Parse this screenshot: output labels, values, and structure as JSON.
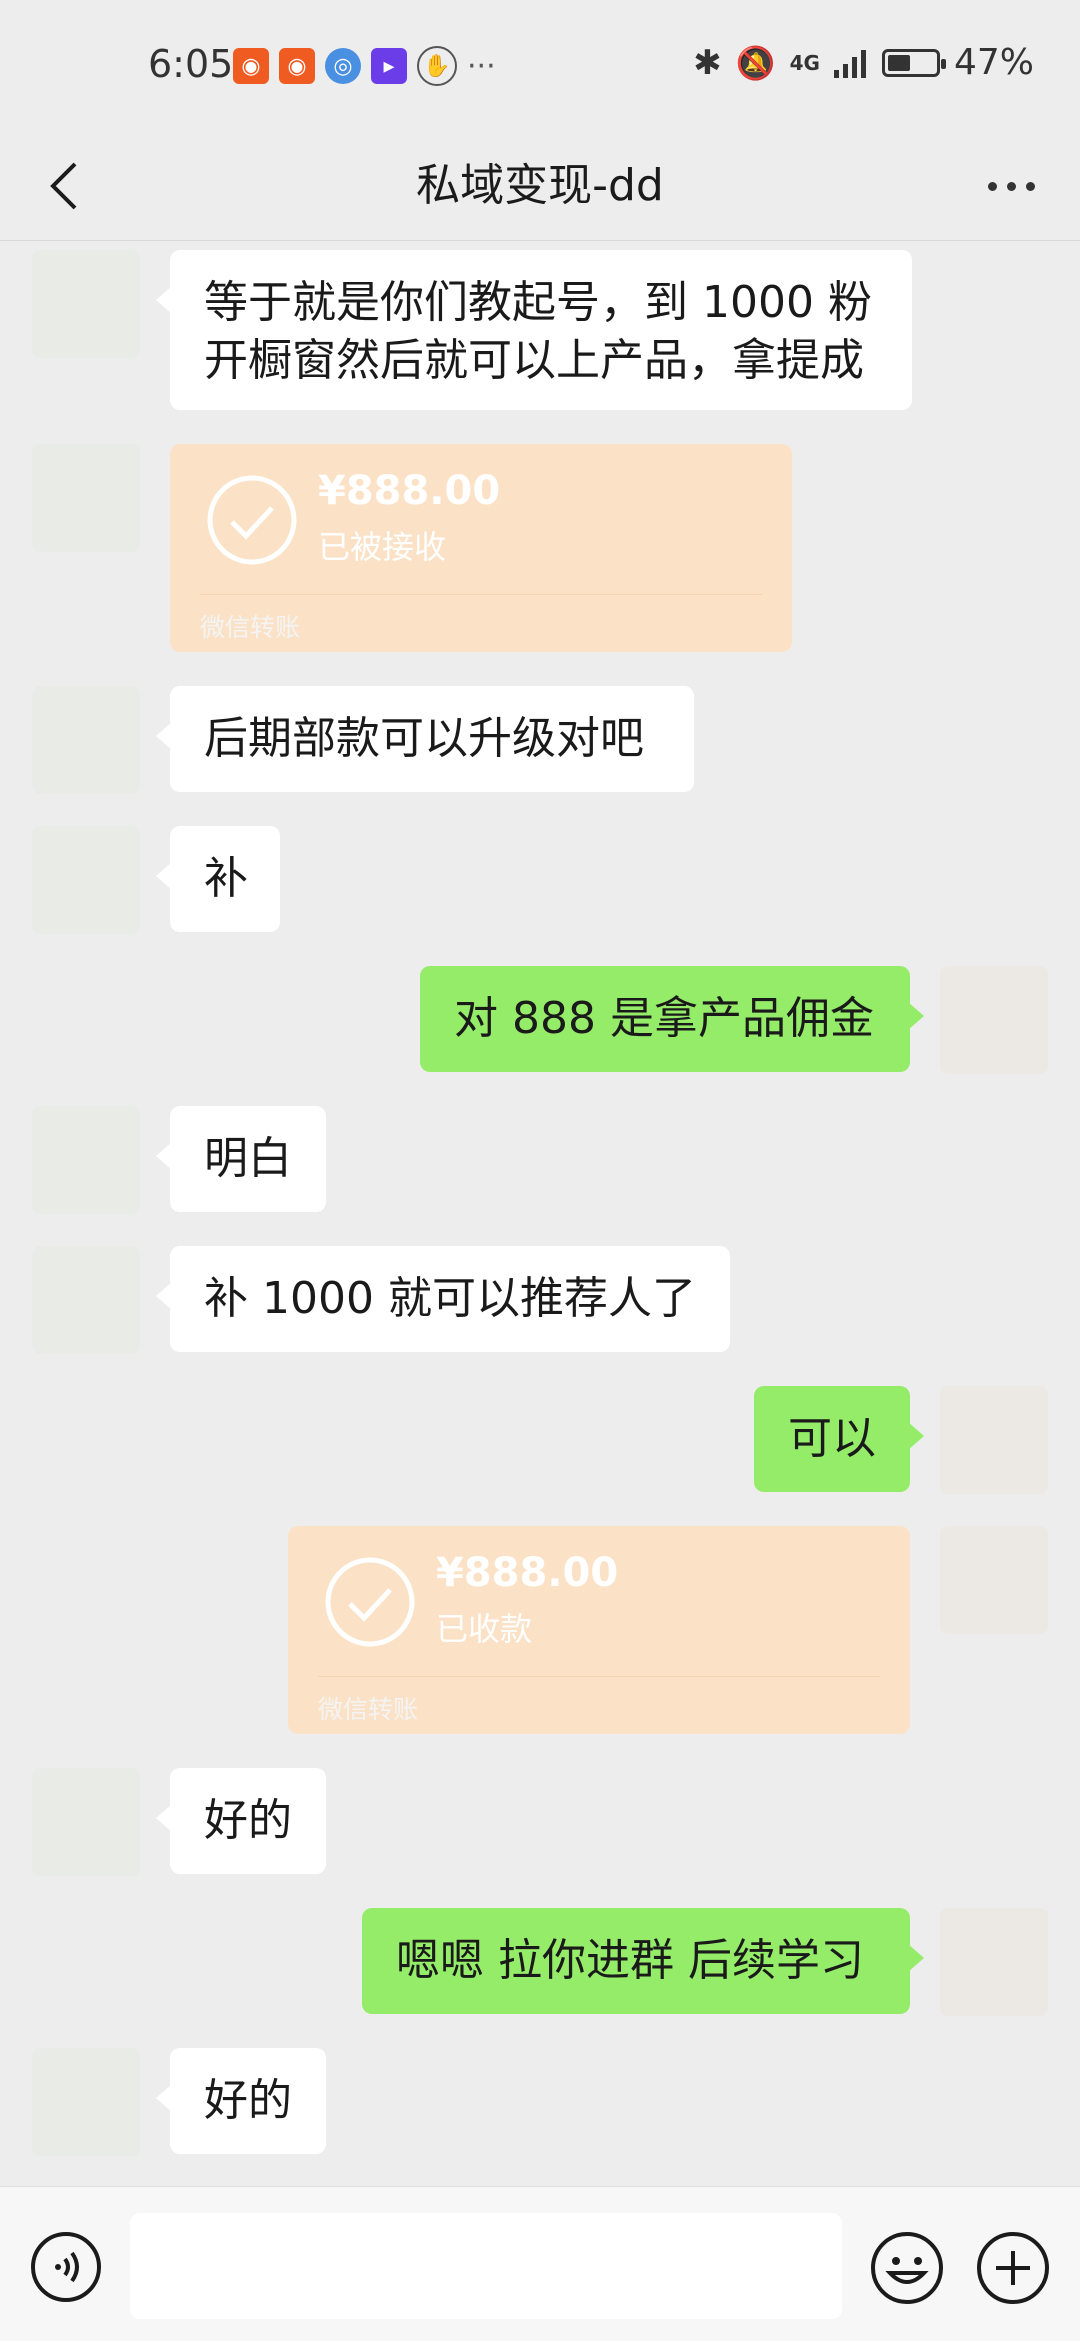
{
  "status_bar": {
    "time": "6:05",
    "network": "4G",
    "battery": "47%",
    "battery_level": 0.47
  },
  "header": {
    "title": "私域变现-dd"
  },
  "messages": [
    {
      "side": "in",
      "type": "text",
      "lines": [
        "等于就是你们教起号，到 1000 粉",
        "开橱窗然后就可以上产品，拿提成"
      ]
    },
    {
      "side": "in",
      "type": "transfer",
      "amount": "¥888.00",
      "status": "已被接收",
      "label": "微信转账"
    },
    {
      "side": "in",
      "type": "text",
      "text": "后期部款可以升级对吧"
    },
    {
      "side": "in",
      "type": "text",
      "text": "补"
    },
    {
      "side": "out",
      "type": "text",
      "text": "对 888 是拿产品佣金"
    },
    {
      "side": "in",
      "type": "text",
      "text": "明白"
    },
    {
      "side": "in",
      "type": "text",
      "text": "补 1000 就可以推荐人了"
    },
    {
      "side": "out",
      "type": "text",
      "text": "可以"
    },
    {
      "side": "out",
      "type": "transfer",
      "amount": "¥888.00",
      "status": "已收款",
      "label": "微信转账"
    },
    {
      "side": "in",
      "type": "text",
      "text": "好的"
    },
    {
      "side": "out",
      "type": "text",
      "text": "嗯嗯 拉你进群 后续学习"
    },
    {
      "side": "in",
      "type": "text",
      "text": "好的"
    }
  ],
  "input": {
    "value": "",
    "placeholder": ""
  },
  "icons": {
    "back": "chevron-left-icon",
    "more": "more-dots-icon",
    "voice": "voice-icon",
    "emoji": "emoji-icon",
    "plus": "plus-icon"
  },
  "colors": {
    "background": "#ededed",
    "outgoing_bubble": "#95ec69",
    "incoming_bubble": "#ffffff",
    "transfer_card": "#fbe2c7"
  }
}
